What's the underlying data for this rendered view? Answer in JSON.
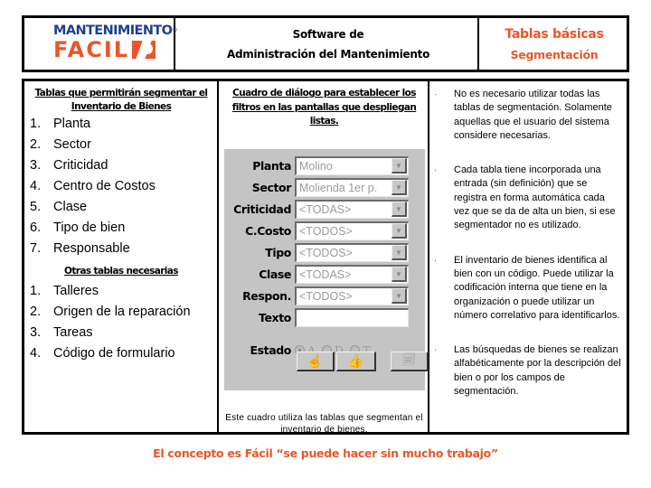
{
  "header": {
    "logo": {
      "line1": "MANTENIMIENTO",
      "mark": "®",
      "line2": "FACIL"
    },
    "title_line1": "Software de",
    "title_line2": "Administración del Mantenimiento",
    "right_line1": "Tablas básicas",
    "right_line2": "Segmentación"
  },
  "left": {
    "heading": "Tablas que permitirán segmentar el Inventario de Bienes",
    "items": [
      {
        "n": "1.",
        "label": "Planta"
      },
      {
        "n": "2.",
        "label": "Sector"
      },
      {
        "n": "3.",
        "label": "Criticidad"
      },
      {
        "n": "4.",
        "label": "Centro de Costos"
      },
      {
        "n": "5.",
        "label": "Clase"
      },
      {
        "n": "6.",
        "label": "Tipo de bien"
      },
      {
        "n": "7.",
        "label": "Responsable"
      }
    ],
    "other_heading": "Otras tablas necesarias",
    "other_items": [
      {
        "n": "1.",
        "label": "Talleres"
      },
      {
        "n": "2.",
        "label": "Origen de la reparación"
      },
      {
        "n": "3.",
        "label": "Tareas"
      },
      {
        "n": "4.",
        "label": "Código de formulario"
      }
    ]
  },
  "middle": {
    "heading": "Cuadro de diálogo para establecer los filtros en las pantallas que despliegan listas.",
    "dialog": {
      "fields": [
        {
          "label": "Planta",
          "value": "Molino"
        },
        {
          "label": "Sector",
          "value": "Molienda 1er p."
        },
        {
          "label": "Criticidad",
          "value": "<TODAS>"
        },
        {
          "label": "C.Costo",
          "value": "<TODOS>"
        },
        {
          "label": "Tipo",
          "value": "<TODOS>"
        },
        {
          "label": "Clase",
          "value": "<TODAS>"
        },
        {
          "label": "Respon.",
          "value": "<TODOS>"
        }
      ],
      "texto_label": "Texto",
      "texto_value": "",
      "estado_label": "Estado",
      "estado_options": [
        "A",
        "D",
        "T"
      ],
      "estado_selected": "A",
      "buttons": [
        {
          "name": "select-hand-button",
          "glyph": "☝"
        },
        {
          "name": "accept-thumb-button",
          "glyph": "👍"
        },
        {
          "name": "cancel-button",
          "glyph": "🗐"
        }
      ]
    },
    "note": "Este cuadro utiliza las tablas que segmentan el inventario de bienes."
  },
  "right": {
    "bullets": [
      "No es necesario utilizar  todas las tablas de segmentación. Solamente aquellas que el usuario del sistema considere necesarias.",
      "Cada tabla tiene incorporada una entrada (sin definición) que se registra en forma automática cada vez que se da de alta un bien, si ese segmentador no es utilizado.",
      "El inventario de bienes identifica al bien con un código. Puede utilizar la codificación interna que tiene en la organización o puede utilizar un número correlativo para identificarlos.",
      "Las búsquedas de bienes se realizan alfabéticamente por la descripción del bien o por los campos de segmentación."
    ],
    "bullet_glyph": "·"
  },
  "footer": "El concepto es Fácil “se puede hacer sin mucho trabajo”",
  "colors": {
    "accent": "#e8562a",
    "logo_blue": "#1f3f8c",
    "panel_gray": "#c4c4c4"
  }
}
